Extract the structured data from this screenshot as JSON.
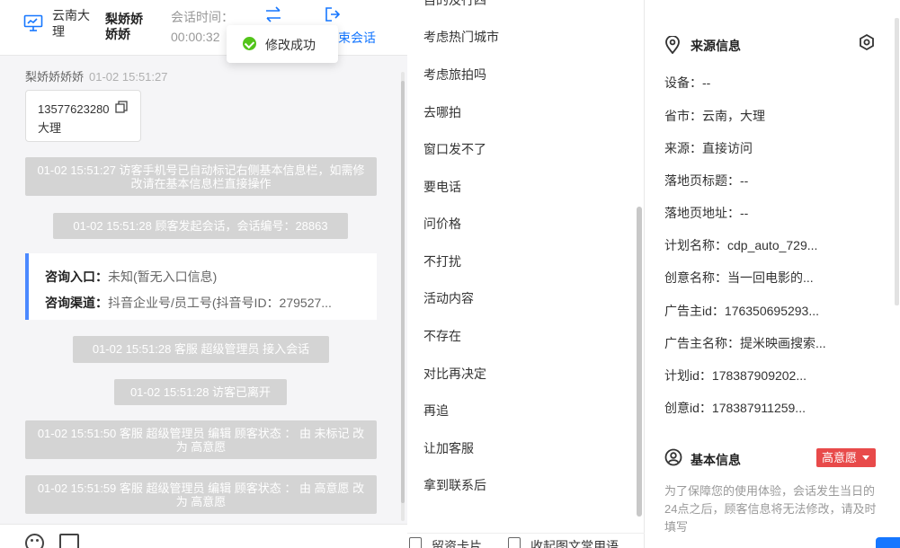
{
  "header": {
    "location": "云南大理",
    "visitor_name": "梨娇娇娇娇",
    "time_label": "会话时间：",
    "time_value": "00:00:32",
    "end_label": "束会话",
    "icons": [
      "monitor-icon",
      "transfer-icon",
      "exit-icon"
    ]
  },
  "toast": {
    "text": "修改成功",
    "icon": "check-circle-icon",
    "color": "#52c41a"
  },
  "chat": {
    "visitor_name": "梨娇娇娇娇",
    "visitor_time": "01-02 15:51:27",
    "card_phone": "13577623280",
    "card_city": "大理",
    "sys_messages": [
      "01-02 15:51:27 访客手机号已自动标记右侧基本信息栏，如需修改请在基本信息栏直接操作",
      "01-02 15:51:28 顾客发起会话，会话编号：28863"
    ],
    "consult": {
      "entry_label": "咨询入口：",
      "entry_value": "未知(暂无入口信息)",
      "channel_label": "咨询渠道：",
      "channel_value": "抖音企业号/员工号(抖音号ID：279527..."
    },
    "sys_messages_2": [
      "01-02 15:51:28 客服 超级管理员 接入会话",
      "01-02 15:51:28 访客已离开",
      "01-02 15:51:50 客服 超级管理员 编辑 顾客状态 ： 由 未标记 改为 高意愿",
      "01-02 15:51:59 客服 超级管理员 编辑 顾客状态 ： 由 高意愿 改为 高意愿"
    ],
    "toolbar_icons": [
      "emoji-icon",
      "image-icon"
    ]
  },
  "quick": {
    "cut_item": "自的及行四",
    "items": [
      "考虑热门城市",
      "考虑旅拍吗",
      "去哪拍",
      "窗口发不了",
      "要电话",
      "问价格",
      "不打扰",
      "活动内容",
      "不存在",
      "对比再决定",
      "再追",
      "让加客服",
      "拿到联系后"
    ],
    "footer_left": "留资卡片",
    "footer_right": "收起图文常用语"
  },
  "info": {
    "source_title": "来源信息",
    "rows": [
      {
        "label": "设备：",
        "value": "--"
      },
      {
        "label": "省市：",
        "value": "云南，大理"
      },
      {
        "label": "来源：",
        "value": "直接访问"
      },
      {
        "label": "落地页标题：",
        "value": "--"
      },
      {
        "label": "落地页地址：",
        "value": "--"
      },
      {
        "label": "计划名称：",
        "value": "cdp_auto_729..."
      },
      {
        "label": "创意名称：",
        "value": "当一回电影的..."
      },
      {
        "label": "广告主id：",
        "value": "176350695293..."
      },
      {
        "label": "广告主名称：",
        "value": "提米映画搜索..."
      },
      {
        "label": "计划id：",
        "value": "178387909202..."
      },
      {
        "label": "创意id：",
        "value": "178387911259..."
      }
    ],
    "basic_title": "基本信息",
    "intent_badge": "高意愿",
    "intent_color": "#e84a4a",
    "note": "为了保障您的使用体验，会话发生当日的24点之后，顾客信息将无法修改，请及时填写"
  }
}
